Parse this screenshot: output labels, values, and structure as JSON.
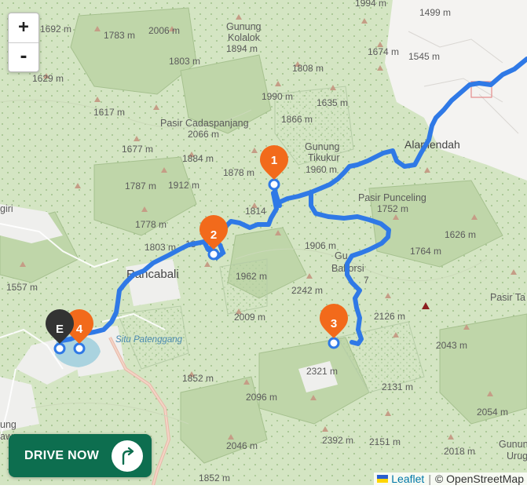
{
  "zoom": {
    "in_label": "+",
    "out_label": "-"
  },
  "drive_button": {
    "label": "DRIVE NOW"
  },
  "attribution": {
    "leaflet": "Leaflet",
    "separator": "|",
    "osm": "© OpenStreetMap"
  },
  "markers": [
    {
      "label": "1",
      "color": "#f26a1b"
    },
    {
      "label": "2",
      "color": "#f26a1b"
    },
    {
      "label": "3",
      "color": "#f26a1b"
    },
    {
      "label": "4",
      "color": "#f26a1b"
    },
    {
      "label": "E",
      "color": "#333333"
    }
  ],
  "place_names": {
    "gunung_kolalok_1": "Gunung",
    "gunung_kolalok_2": "Kolalok",
    "gunung_tikukur_1": "Gunung",
    "gunung_tikukur_2": "Tikukur",
    "pasir_cadaspanjang": "Pasir Cadaspanjang",
    "pasir_punceling": "Pasir Punceling",
    "alamendah": "Alamendah",
    "rancabali": "Rancabali",
    "situ_patenggang": "Situ Patenggang",
    "gunung_bakorsi_1": "Gu",
    "gunung_bakorsi_2": "Bakorsi",
    "pasir_tanjung": "Pasir Ta",
    "gunung_urug_1": "Gunun",
    "gunung_urug_2": "Urug",
    "edge_giri": "giri",
    "edge_gunung": "ung",
    "edge_awey": "awey"
  },
  "elevations": {
    "e1994": "1994 m",
    "e1499": "1499 m",
    "e1692": "1692 m",
    "e1783": "1783 m",
    "e2006": "2006 m",
    "e1894": "1894 m",
    "e1674": "1674 m",
    "e1545": "1545 m",
    "e1803a": "1803 m",
    "e1808": "1808 m",
    "e1629": "1629 m",
    "e1990": "1990 m",
    "e1617": "1617 m",
    "e1635": "1635 m",
    "e1866": "1866 m",
    "e2066": "2066 m",
    "e1677": "1677 m",
    "e1884": "1884 m",
    "e1960": "1960 m",
    "e1878": "1878 m",
    "e1787": "1787 m",
    "e1912": "1912 m",
    "e1752": "1752 m",
    "e1814": "1814",
    "e1778": "1778 m",
    "e1626": "1626 m",
    "e1803b": "1803 m",
    "e18x": "18",
    "e1906": "1906 m",
    "e1764": "1764 m",
    "e1962": "1962 m",
    "e1557": "1557 m",
    "e2242": "2242 m",
    "e7": "7",
    "e2126": "2126 m",
    "e2009": "2009 m",
    "e2043": "2043 m",
    "e1852a": "1852 m",
    "e2321": "2321 m",
    "e2131": "2131 m",
    "e2096": "2096 m",
    "e2054": "2054 m",
    "e2392": "2392 m",
    "e2151": "2151 m",
    "e2046": "2046 m",
    "e2018": "2018 m",
    "e1852b": "1852 m"
  },
  "colors": {
    "route": "#2f79e6",
    "marker": "#f26a1b",
    "end_marker": "#333333",
    "button": "#0d6e4f",
    "forest": "#c5dbb0",
    "urban": "#f4f3f1"
  }
}
